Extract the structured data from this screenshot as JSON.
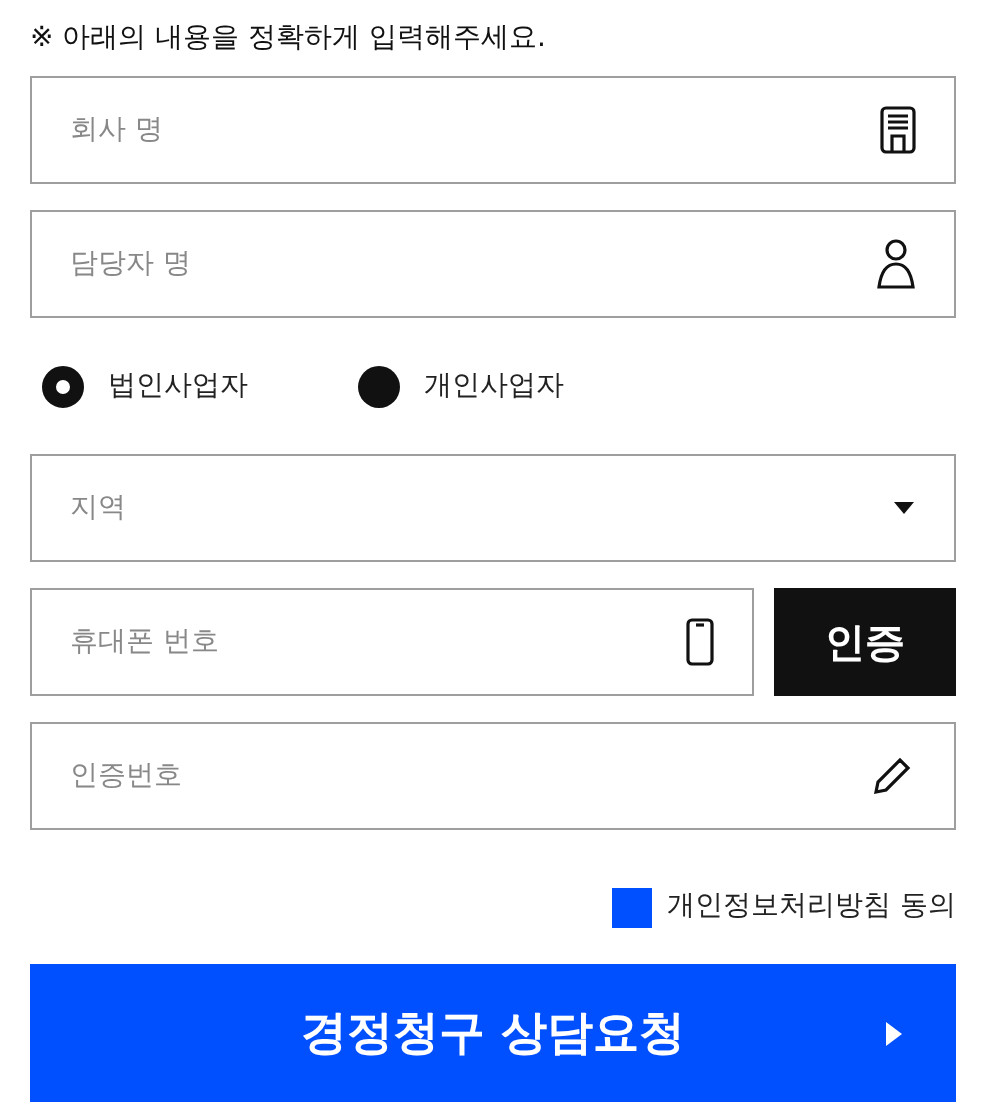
{
  "notice": "※ 아래의 내용을 정확하게 입력해주세요.",
  "company_field": {
    "placeholder": "회사 명"
  },
  "contact_field": {
    "placeholder": "담당자 명"
  },
  "business_type": [
    {
      "label": "법인사업자",
      "selected": true
    },
    {
      "label": "개인사업자",
      "selected": false
    }
  ],
  "region_select": {
    "placeholder": "지역"
  },
  "phone_field": {
    "placeholder": "휴대폰 번호"
  },
  "verify_button": "인증",
  "code_field": {
    "placeholder": "인증번호"
  },
  "privacy_consent": {
    "label": "개인정보처리방침 동의",
    "checked": false
  },
  "submit_button": "경정청구 상담요청"
}
